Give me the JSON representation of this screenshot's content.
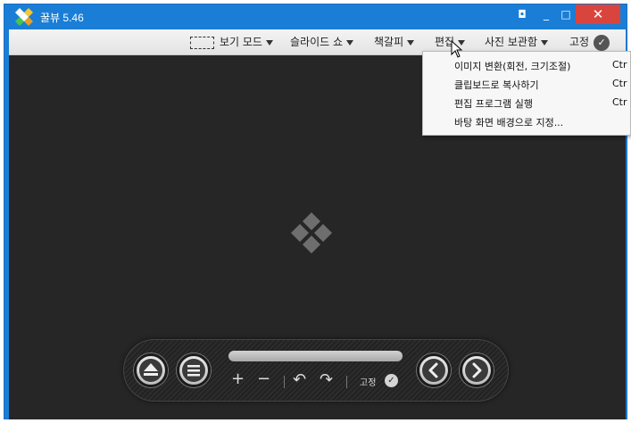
{
  "window": {
    "title": "꿀뷰 5.46",
    "controls": {
      "aspect_glyph": "◘",
      "minimize_glyph": "_",
      "maximize_glyph": "□",
      "close_glyph": "✕"
    }
  },
  "menubar": {
    "view_mode": "보기 모드",
    "slideshow": "슬라이드 쇼",
    "bookmark": "책갈피",
    "edit": "편집",
    "photo_storage": "사진 보관함",
    "pin": "고정",
    "pin_check": "✓"
  },
  "edit_menu": {
    "items": [
      {
        "label": "이미지 변환(회전, 크기조절)",
        "shortcut": "Ctr"
      },
      {
        "label": "클립보드로 복사하기",
        "shortcut": "Ctr"
      },
      {
        "label": "편집 프로그램 실행",
        "shortcut": "Ctr"
      },
      {
        "label": "바탕 화면 배경으로 지정...",
        "shortcut": ""
      }
    ]
  },
  "controls": {
    "zoom_in": "+",
    "zoom_out": "−",
    "rotate_left": "↶",
    "rotate_right": "↷",
    "pin_label": "고정",
    "pin_check": "✓"
  },
  "colors": {
    "titlebar": "#1a7ed6",
    "close_button": "#d9453d",
    "viewer_background": "#262626",
    "menubar": "#ececec"
  },
  "icons": {
    "app_logo": "honeyview-logo-icon",
    "center_logo": "honeyview-placeholder-icon",
    "eject": "eject-icon",
    "menu": "hamburger-menu-icon",
    "prev": "chevron-left-icon",
    "next": "chevron-right-icon"
  }
}
